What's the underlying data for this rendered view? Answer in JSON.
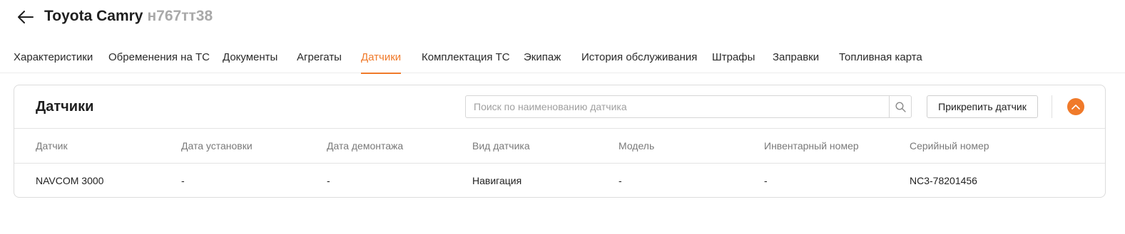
{
  "header": {
    "title": "Toyota Camry",
    "plate": "н767тт38"
  },
  "tabs": [
    {
      "label": "Характеристики"
    },
    {
      "label": "Обременения на ТС"
    },
    {
      "label": "Документы"
    },
    {
      "label": "Агрегаты"
    },
    {
      "label": "Датчики",
      "active": true
    },
    {
      "label": "Комплектация ТС"
    },
    {
      "label": "Экипаж"
    },
    {
      "label": "История обслуживания"
    },
    {
      "label": "Штрафы"
    },
    {
      "label": "Заправки"
    },
    {
      "label": "Топливная карта"
    }
  ],
  "sensors": {
    "title": "Датчики",
    "search": {
      "placeholder": "Поиск по наименованию датчика",
      "value": ""
    },
    "attach_label": "Прикрепить датчик",
    "columns": [
      "Датчик",
      "Дата установки",
      "Дата демонтажа",
      "Вид датчика",
      "Модель",
      "Инвентарный номер",
      "Серийный номер"
    ],
    "rows": [
      [
        "NAVCOM 3000",
        "-",
        "-",
        "Навигация",
        "-",
        "-",
        "NC3-78201456"
      ]
    ]
  },
  "colors": {
    "accent": "#f07a2a",
    "muted_text": "#a9a9a9"
  },
  "icons": {
    "back": "arrow-left-icon",
    "search": "search-icon",
    "collapse": "chevron-up-icon"
  }
}
